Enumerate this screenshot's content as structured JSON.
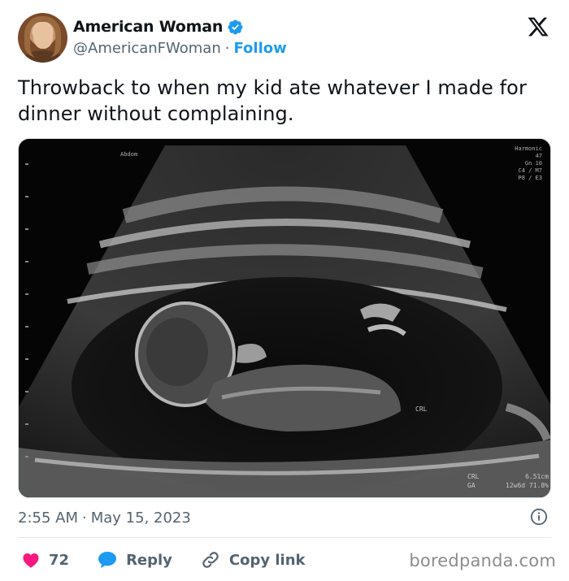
{
  "account": {
    "display_name": "American Woman",
    "handle": "@AmericanFWoman",
    "separator": "·",
    "follow_label": "Follow",
    "verified": true
  },
  "tweet": {
    "text": "Throwback to when my kid ate whatever I made for dinner without complaining.",
    "time": "2:55 AM",
    "date": "May 15, 2023",
    "meta_separator": "·"
  },
  "media": {
    "overlay_top_right": [
      "Harmonic",
      "47",
      "Gn 10",
      "C4 / M7",
      "P8 / E3"
    ],
    "overlay_top_left": [
      "Abdom"
    ],
    "overlay_crl": "CRL",
    "overlay_bottom_right_line1": "CRL",
    "overlay_bottom_right_value1": "6.51cm",
    "overlay_bottom_right_line2": "GA",
    "overlay_bottom_right_value2": "12w6d 71.8%"
  },
  "actions": {
    "like_count": "72",
    "reply_label": "Reply",
    "copy_link_label": "Copy link"
  },
  "watermark": "boredpanda.com",
  "colors": {
    "accent": "#1d9bf0",
    "like": "#f91880",
    "text": "#0f1419",
    "muted": "#536471"
  },
  "icons": [
    "verified-badge-icon",
    "x-logo-icon",
    "info-icon",
    "heart-icon",
    "reply-bubble-icon",
    "link-icon"
  ]
}
